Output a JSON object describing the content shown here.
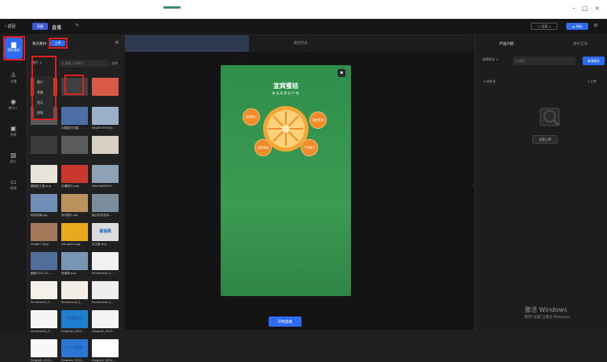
{
  "titlebar": {
    "window_controls": "– □ ×"
  },
  "topbar": {
    "back_label": "‹ 返回",
    "mode_label": "直播",
    "title": "直播",
    "right_option_label": "▢ 竖屏 ∨",
    "save_label": "保存"
  },
  "rail": {
    "items": [
      {
        "label": "我的素材",
        "icon": "folder-icon"
      },
      {
        "label": "主播",
        "icon": "person-icon"
      },
      {
        "label": "数字人",
        "icon": "avatar-icon"
      },
      {
        "label": "背景",
        "icon": "background-icon"
      },
      {
        "label": "图片",
        "icon": "image-icon"
      },
      {
        "label": "视频",
        "icon": "video-icon"
      }
    ]
  },
  "panel": {
    "title": "我的素材",
    "upload_label": "上传",
    "filter_label": "图片 ∧",
    "search_placeholder": "Q 请输入关键字",
    "select_label": "选择",
    "dropdown": [
      "图片",
      "背景",
      "音乐",
      "视频"
    ],
    "items": [
      {
        "name": "",
        "color": "#c7402d"
      },
      {
        "name": "",
        "color": "#404040"
      },
      {
        "name": "",
        "color": "#d85a46"
      },
      {
        "name": "",
        "color": "#5a5a5a"
      },
      {
        "name": "中国银行向建...",
        "color": "#4a6fa5"
      },
      {
        "name": "d5bd0787f6e5...",
        "color": "#9ab0c8"
      },
      {
        "name": "",
        "color": "#3c3c3c"
      },
      {
        "name": "",
        "color": "#5c5c5c"
      },
      {
        "name": "",
        "color": "#d8d0c2"
      },
      {
        "name": "模板制工程.png",
        "color": "#e8e4da"
      },
      {
        "name": "交通银行.png",
        "color": "#c9382c"
      },
      {
        "name": "WechatIMG26...",
        "color": "#8ea2b6"
      },
      {
        "name": "两会背景.jpg",
        "color": "#6f8fb6"
      },
      {
        "name": "测试图片.jpg",
        "color": "#b9925e"
      },
      {
        "name": "画云前台技术...",
        "color": "#7b8c9a"
      },
      {
        "name": "image 1.png",
        "color": "#a57a5b"
      },
      {
        "name": "xiangrikui.jpg",
        "color": "#e9a91f"
      },
      {
        "name": "反文景.png",
        "color": "#dcdcdc"
      },
      {
        "name": "截屏2022-02-...",
        "color": "#4f6f9a"
      },
      {
        "name": "背景图.png",
        "color": "#7896b4"
      },
      {
        "name": "Screenshot_2...",
        "color": "#f2f2f2"
      },
      {
        "name": "Screenshot_2...",
        "color": "#f4f1ea"
      },
      {
        "name": "Screenshot_2...",
        "color": "#f2ede6"
      },
      {
        "name": "Screenshot_2...",
        "color": "#eeeeee"
      },
      {
        "name": "Screenshot_2...",
        "color": "#f5f5f5"
      },
      {
        "name": "Dingtalk_2022...",
        "color": "#1f7ecf"
      },
      {
        "name": "Dingtalk_2022...",
        "color": "#f3f3f3"
      },
      {
        "name": "Dingtalk_2022...",
        "color": "#f7f7f7"
      },
      {
        "name": "Dingtalk_2022...",
        "color": "#2b76d2"
      },
      {
        "name": "Dingtalk_2022...",
        "color": "#ffffff"
      }
    ],
    "tile_texts": {
      "t4": "看保网",
      "t7": "中城实业",
      "t8": "少儿夏夜"
    }
  },
  "canvas": {
    "tab_label": "播放列表",
    "phone_title": "宜宾蜜桔",
    "phone_subtitle": "来自高原好产地",
    "bubbles": [
      "鲜甜多汁",
      "新鲜采摘",
      "品质保证",
      "产地直发"
    ],
    "start_label": "开始直播"
  },
  "rpanel": {
    "tab_product": "产品介绍",
    "tab_interaction": "聊天互动",
    "select_label": "选择版本 ∨",
    "search_placeholder": "Q 搜索",
    "new_label": "新增版本",
    "unnamed_label": "▾ 未命名",
    "upload_link": "上传",
    "upload_now": "立即上传",
    "watermark_title": "激活 Windows",
    "watermark_sub": "转到\"设置\"以激活 Windows。"
  }
}
